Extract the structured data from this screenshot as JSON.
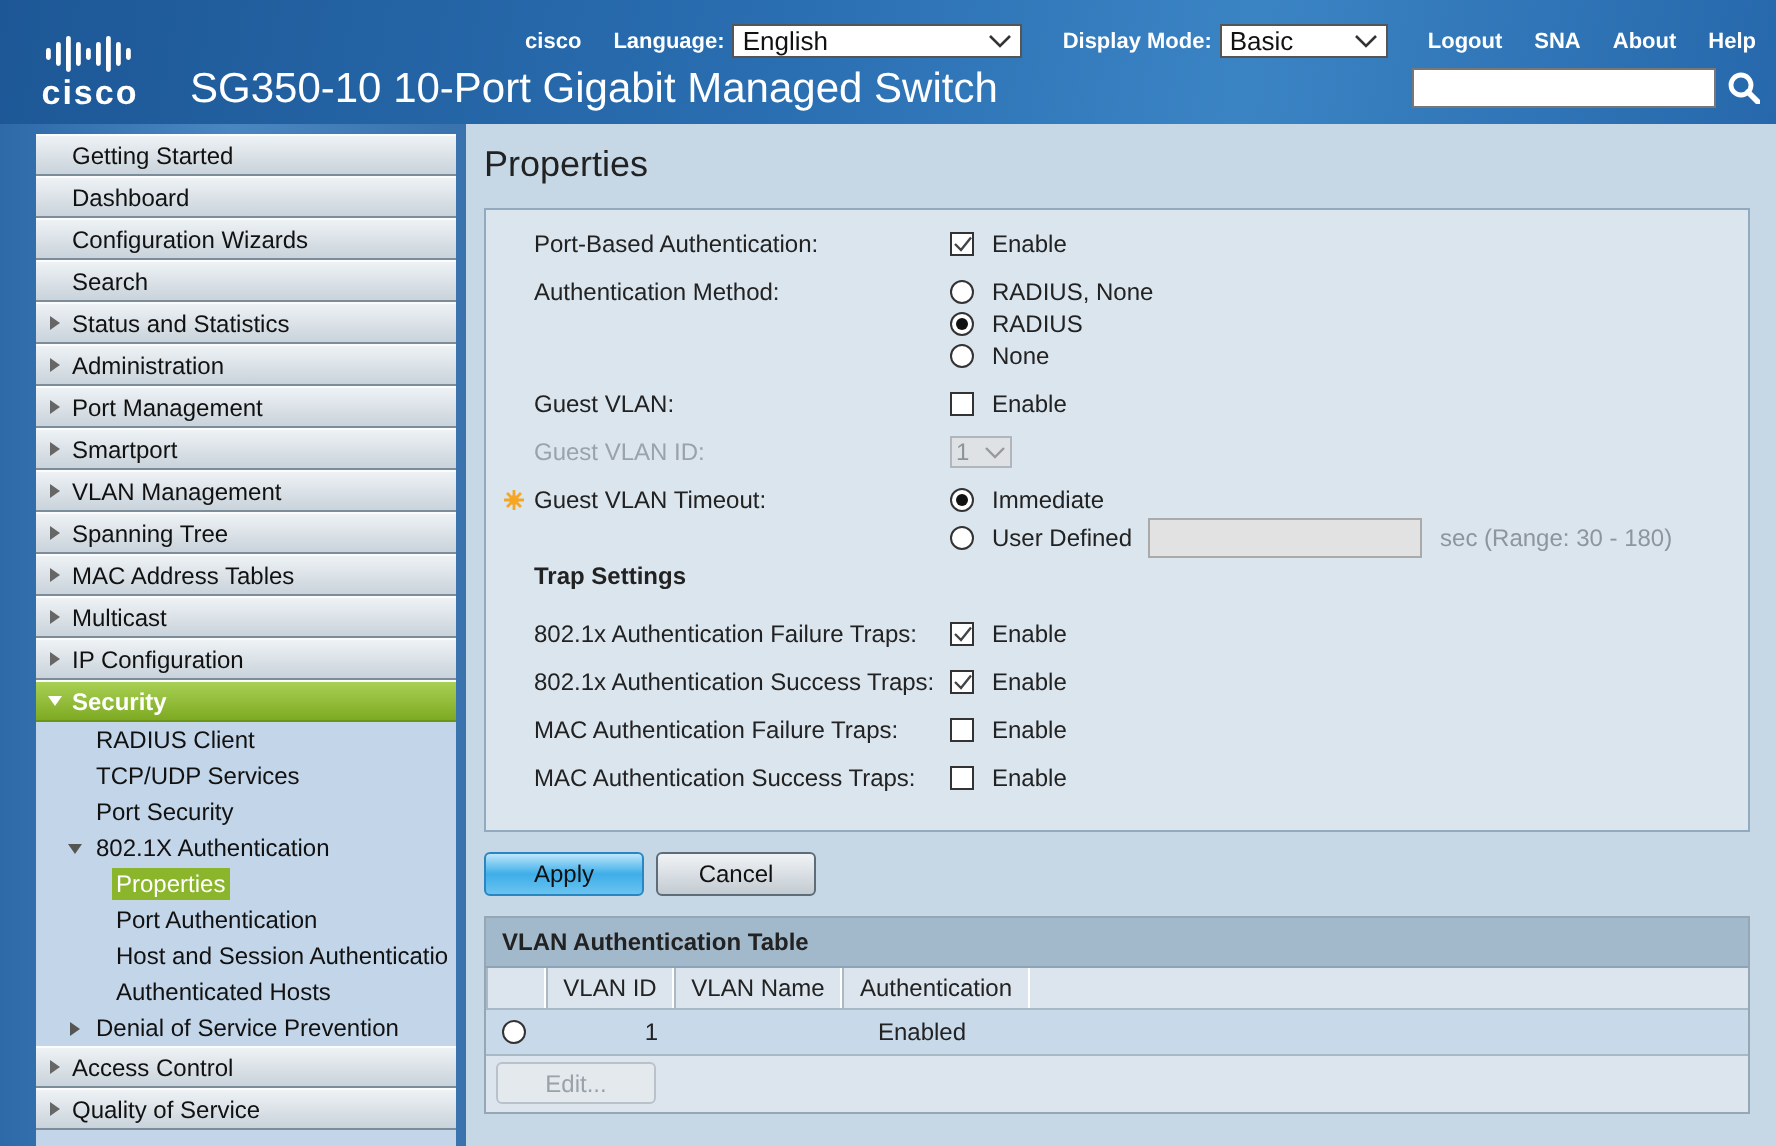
{
  "header": {
    "logo_text": "cisco",
    "title": "SG350-10 10-Port Gigabit Managed Switch",
    "user": "cisco",
    "language": {
      "label": "Language:",
      "value": "English"
    },
    "display_mode": {
      "label": "Display Mode:",
      "value": "Basic"
    },
    "links": [
      "Logout",
      "SNA",
      "About",
      "Help"
    ]
  },
  "sidebar": {
    "items": [
      {
        "label": "Getting Started",
        "expandable": false,
        "expanded": false
      },
      {
        "label": "Dashboard",
        "expandable": false,
        "expanded": false
      },
      {
        "label": "Configuration Wizards",
        "expandable": false,
        "expanded": false
      },
      {
        "label": "Search",
        "expandable": false,
        "expanded": false
      },
      {
        "label": "Status and Statistics",
        "expandable": true,
        "expanded": false
      },
      {
        "label": "Administration",
        "expandable": true,
        "expanded": false
      },
      {
        "label": "Port Management",
        "expandable": true,
        "expanded": false
      },
      {
        "label": "Smartport",
        "expandable": true,
        "expanded": false
      },
      {
        "label": "VLAN Management",
        "expandable": true,
        "expanded": false
      },
      {
        "label": "Spanning Tree",
        "expandable": true,
        "expanded": false
      },
      {
        "label": "MAC Address Tables",
        "expandable": true,
        "expanded": false
      },
      {
        "label": "Multicast",
        "expandable": true,
        "expanded": false
      },
      {
        "label": "IP Configuration",
        "expandable": true,
        "expanded": false
      },
      {
        "label": "Security",
        "expandable": true,
        "expanded": true,
        "children": [
          {
            "label": "RADIUS Client",
            "expandable": false,
            "expanded": false,
            "selected": false
          },
          {
            "label": "TCP/UDP Services",
            "expandable": false,
            "expanded": false,
            "selected": false
          },
          {
            "label": "Port Security",
            "expandable": false,
            "expanded": false,
            "selected": false
          },
          {
            "label": "802.1X Authentication",
            "expandable": true,
            "expanded": true,
            "selected": false,
            "children": [
              {
                "label": "Properties",
                "selected": true
              },
              {
                "label": "Port Authentication",
                "selected": false
              },
              {
                "label": "Host and Session Authenticatio",
                "selected": false
              },
              {
                "label": "Authenticated Hosts",
                "selected": false
              }
            ]
          },
          {
            "label": "Denial of Service Prevention",
            "expandable": true,
            "expanded": false,
            "selected": false
          }
        ]
      },
      {
        "label": "Access Control",
        "expandable": true,
        "expanded": false
      },
      {
        "label": "Quality of Service",
        "expandable": true,
        "expanded": false
      }
    ]
  },
  "page_title": "Properties",
  "form": {
    "rows": [
      {
        "kind": "checkbox",
        "label": "Port-Based Authentication:",
        "option": "Enable",
        "checked": true
      },
      {
        "kind": "radio",
        "label": "Authentication Method:",
        "options": [
          {
            "label": "RADIUS, None",
            "selected": false
          },
          {
            "label": "RADIUS",
            "selected": true
          },
          {
            "label": "None",
            "selected": false
          }
        ]
      },
      {
        "kind": "checkbox",
        "label": "Guest VLAN:",
        "option": "Enable",
        "checked": false
      },
      {
        "kind": "select",
        "label": "Guest VLAN ID:",
        "value": "1",
        "disabled": true
      },
      {
        "kind": "radio",
        "label": "Guest VLAN Timeout:",
        "required": true,
        "options": [
          {
            "label": "Immediate",
            "selected": true
          },
          {
            "label": "User Defined",
            "selected": false,
            "field": {
              "disabled": true
            },
            "hint": "sec (Range: 30 - 180)"
          }
        ]
      },
      {
        "kind": "heading",
        "label": "Trap Settings"
      },
      {
        "kind": "checkbox",
        "label": "802.1x Authentication Failure Traps:",
        "option": "Enable",
        "checked": true
      },
      {
        "kind": "checkbox",
        "label": "802.1x Authentication Success Traps:",
        "option": "Enable",
        "checked": true
      },
      {
        "kind": "checkbox",
        "label": "MAC Authentication Failure Traps:",
        "option": "Enable",
        "checked": false
      },
      {
        "kind": "checkbox",
        "label": "MAC Authentication Success Traps:",
        "option": "Enable",
        "checked": false
      }
    ]
  },
  "buttons": [
    {
      "label": "Apply",
      "kind": "primary"
    },
    {
      "label": "Cancel",
      "kind": "secondary"
    }
  ],
  "table": {
    "title": "VLAN Authentication Table",
    "columns": [
      "VLAN ID",
      "VLAN Name",
      "Authentication"
    ],
    "rows": [
      {
        "selected": false,
        "vlan_id": "1",
        "authentication": "Enabled"
      }
    ],
    "edit_button": {
      "label": "Edit...",
      "disabled": true
    }
  }
}
